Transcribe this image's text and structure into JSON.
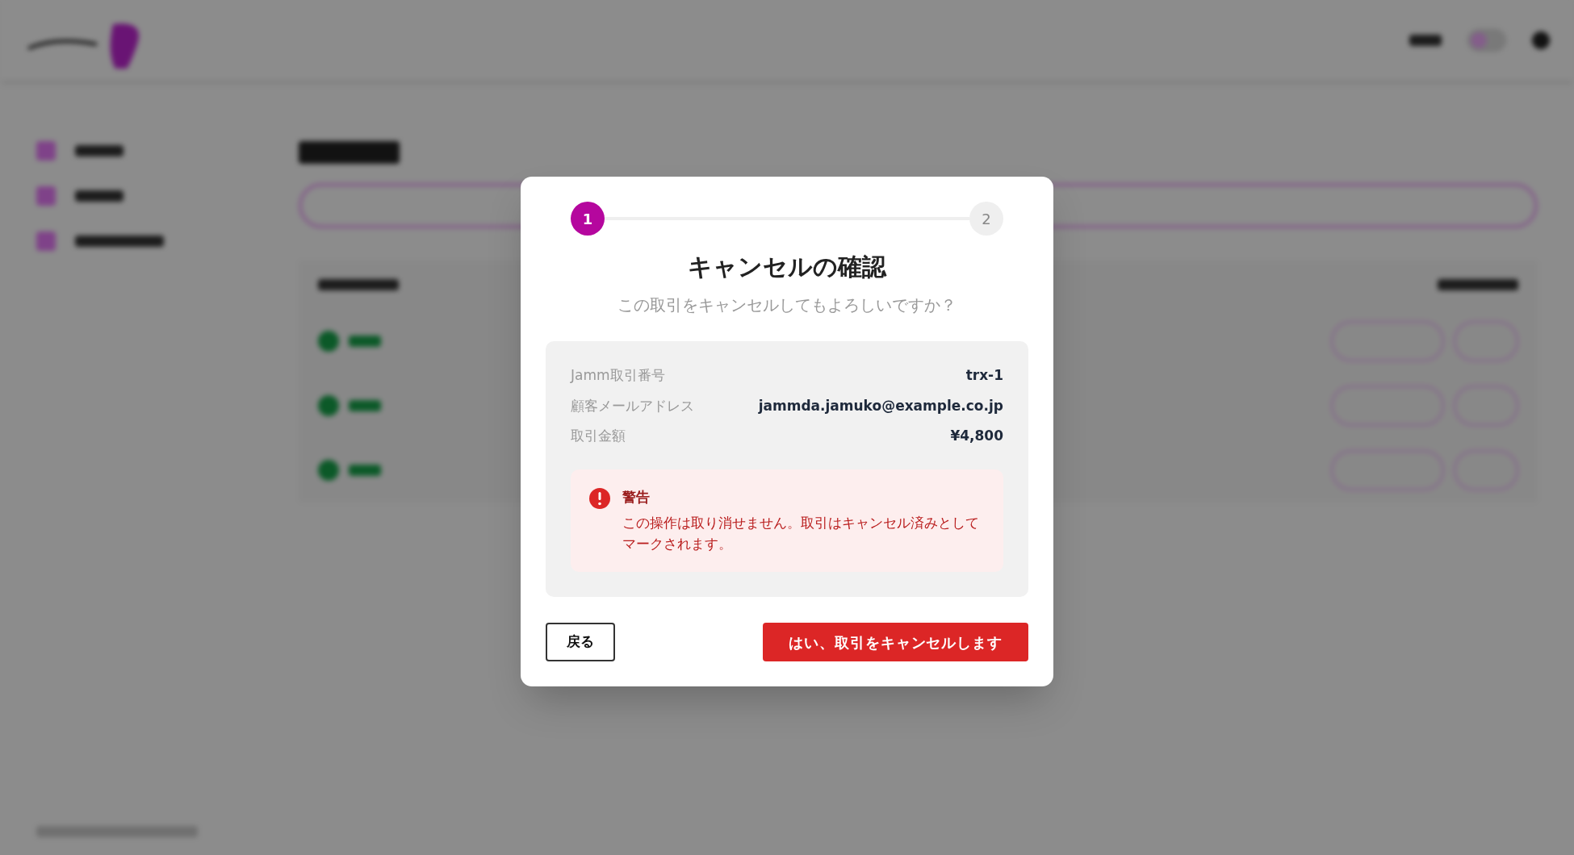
{
  "header": {
    "toggle": {
      "on": false
    }
  },
  "stepper": {
    "steps": [
      {
        "label": "1",
        "selected": true
      },
      {
        "label": "2",
        "selected": false
      }
    ]
  },
  "dialog": {
    "title": "キャンセルの確認",
    "subtitle": "この取引をキャンセルしてもよろしいですか？",
    "details": [
      {
        "label": "Jamm取引番号",
        "value": "trx-1"
      },
      {
        "label": "顧客メールアドレス",
        "value": "jammda.jamuko@example.co.jp"
      },
      {
        "label": "取引金額",
        "value": "¥4,800"
      }
    ],
    "warning": {
      "title": "警告",
      "message": "この操作は取り消せません。取引はキャンセル済みとしてマークされます。"
    },
    "buttons": [
      {
        "label": "戻る",
        "kind": "secondary"
      },
      {
        "label": "はい、取引をキャンセルします",
        "kind": "danger"
      }
    ]
  }
}
